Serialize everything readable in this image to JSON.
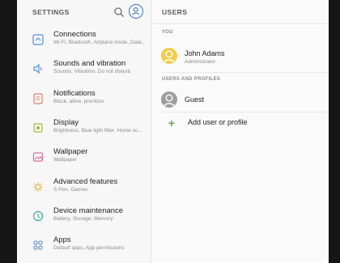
{
  "settings": {
    "title": "SETTINGS",
    "items": [
      {
        "label": "Connections",
        "sub": "Wi-Fi, Bluetooth, Airplane mode, Data...",
        "icon": "connections-icon"
      },
      {
        "label": "Sounds and vibration",
        "sub": "Sounds, Vibration, Do not disturb",
        "icon": "sound-icon"
      },
      {
        "label": "Notifications",
        "sub": "Block, allow, prioritize",
        "icon": "notifications-icon"
      },
      {
        "label": "Display",
        "sub": "Brightness, Blue light filter, Home sc...",
        "icon": "display-icon"
      },
      {
        "label": "Wallpaper",
        "sub": "Wallpaper",
        "icon": "wallpaper-icon"
      },
      {
        "label": "Advanced features",
        "sub": "S Pen, Games",
        "icon": "advanced-features-icon"
      },
      {
        "label": "Device maintenance",
        "sub": "Battery, Storage, Memory",
        "icon": "device-maintenance-icon"
      },
      {
        "label": "Apps",
        "sub": "Default apps, App permissions",
        "icon": "apps-icon"
      }
    ]
  },
  "users": {
    "title": "USERS",
    "you_label": "YOU",
    "owner": {
      "name": "John Adams",
      "role": "Administrator"
    },
    "profiles_label": "USERS AND PROFILES",
    "guest": {
      "name": "Guest"
    },
    "add_label": "Add user or profile"
  },
  "colors": {
    "accent": "#3a75c4",
    "owner_avatar": "#f3cd4a",
    "guest_avatar": "#9e9e9e",
    "add": "#6aa84f"
  }
}
